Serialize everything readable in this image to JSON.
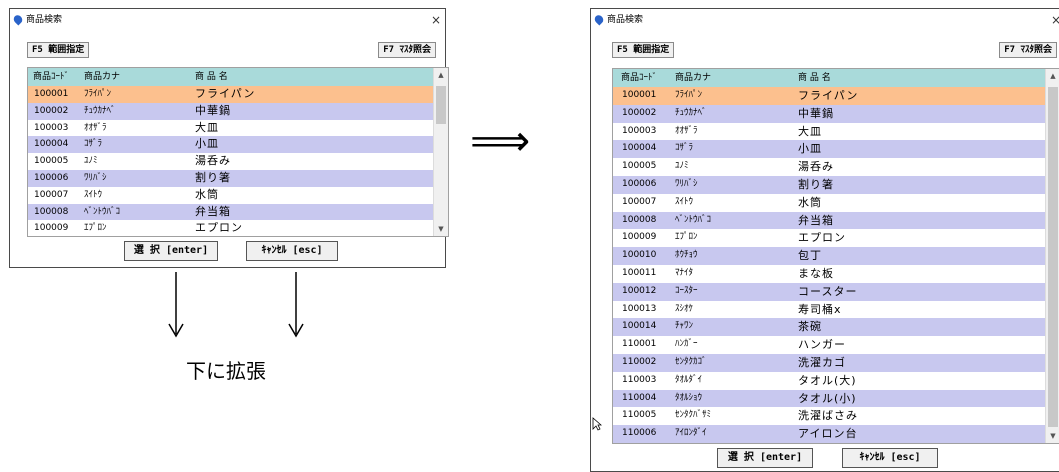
{
  "window": {
    "title": "商品検索",
    "close": "×",
    "f5_label": "F5 範囲指定",
    "f7_label": "F7 ﾏｽﾀ照会",
    "select_label": "選 択 [enter]",
    "cancel_label": "ｷｬﾝｾﾙ [esc]"
  },
  "columns": {
    "code": "商品ｺｰﾄﾞ",
    "kana": "商品カナ",
    "name": "商 品 名"
  },
  "rows": [
    {
      "code": "100001",
      "kana": "ﾌﾗｲﾊﾟﾝ",
      "name": "フライパン"
    },
    {
      "code": "100002",
      "kana": "ﾁｭｳｶﾅﾍﾞ",
      "name": "中華鍋"
    },
    {
      "code": "100003",
      "kana": "ｵｵｻﾞﾗ",
      "name": "大皿"
    },
    {
      "code": "100004",
      "kana": "ｺｻﾞﾗ",
      "name": "小皿"
    },
    {
      "code": "100005",
      "kana": "ﾕﾉﾐ",
      "name": "湯呑み"
    },
    {
      "code": "100006",
      "kana": "ﾜﾘﾊﾞｼ",
      "name": "割り箸"
    },
    {
      "code": "100007",
      "kana": "ｽｲﾄｳ",
      "name": "水筒"
    },
    {
      "code": "100008",
      "kana": "ﾍﾞﾝﾄｳﾊﾞｺ",
      "name": "弁当箱"
    },
    {
      "code": "100009",
      "kana": "ｴﾌﾟﾛﾝ",
      "name": "エプロン"
    },
    {
      "code": "100010",
      "kana": "ﾎｳﾁｮｳ",
      "name": "包丁"
    },
    {
      "code": "100011",
      "kana": "ﾏﾅｲﾀ",
      "name": "まな板"
    },
    {
      "code": "100012",
      "kana": "ｺｰｽﾀｰ",
      "name": "コースター"
    },
    {
      "code": "100013",
      "kana": "ｽｼｵｹ",
      "name": "寿司桶x"
    },
    {
      "code": "100014",
      "kana": "ﾁｬﾜﾝ",
      "name": "茶碗"
    },
    {
      "code": "110001",
      "kana": "ﾊﾝｶﾞｰ",
      "name": "ハンガー"
    },
    {
      "code": "110002",
      "kana": "ｾﾝﾀｸｶｺﾞ",
      "name": "洗濯カゴ"
    },
    {
      "code": "110003",
      "kana": "ﾀｵﾙﾀﾞｲ",
      "name": "タオル(大)"
    },
    {
      "code": "110004",
      "kana": "ﾀｵﾙｼｮｳ",
      "name": "タオル(小)"
    },
    {
      "code": "110005",
      "kana": "ｾﾝﾀｸﾊﾞｻﾐ",
      "name": "洗濯ばさみ"
    },
    {
      "code": "110006",
      "kana": "ｱｲﾛﾝﾀﾞｲ",
      "name": "アイロン台"
    }
  ],
  "small_visible_rows": 9,
  "caption": "下に拡張",
  "arrow_glyph": "⟹",
  "colors": {
    "header_bg": "#a9dada",
    "row_alt": "#c8c8ef",
    "row_selected": "#fcc08e",
    "icon": "#2a63c9"
  }
}
